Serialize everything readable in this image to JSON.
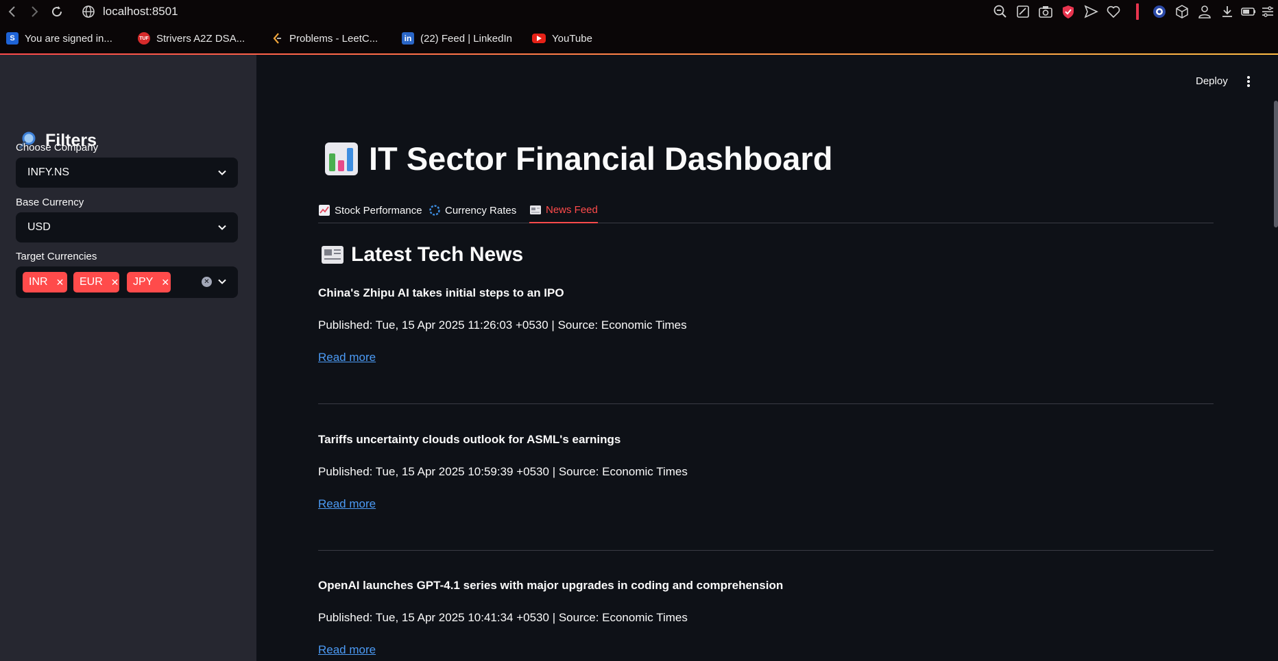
{
  "browser": {
    "url": "localhost:8501",
    "bookmarks": [
      {
        "label": "You are signed in...",
        "icon": "s-logo-icon"
      },
      {
        "label": "Strivers A2Z DSA...",
        "icon": "tuf-logo-icon"
      },
      {
        "label": "Problems - LeetC...",
        "icon": "leetcode-logo-icon"
      },
      {
        "label": "(22) Feed | LinkedIn",
        "icon": "linkedin-logo-icon"
      },
      {
        "label": "YouTube",
        "icon": "youtube-logo-icon"
      }
    ]
  },
  "sidebar": {
    "title": "Filters",
    "company": {
      "label": "Choose Company",
      "value": "INFY.NS"
    },
    "base_currency": {
      "label": "Base Currency",
      "value": "USD"
    },
    "target_currencies": {
      "label": "Target Currencies",
      "tags": [
        "INR",
        "EUR",
        "JPY"
      ]
    }
  },
  "header": {
    "deploy_label": "Deploy"
  },
  "main": {
    "title": "IT Sector Financial Dashboard",
    "tabs": [
      {
        "label": "Stock Performance",
        "icon": "chart-up-icon"
      },
      {
        "label": "Currency Rates",
        "icon": "globe-spin-icon"
      },
      {
        "label": "News Feed",
        "icon": "newspaper-icon",
        "active": true
      }
    ],
    "section_title": "Latest Tech News",
    "news": [
      {
        "title": "China's Zhipu AI takes initial steps to an IPO",
        "meta": "Published: Tue, 15 Apr 2025 11:26:03 +0530 | Source: Economic Times",
        "link": "Read more"
      },
      {
        "title": "Tariffs uncertainty clouds outlook for ASML's earnings",
        "meta": "Published: Tue, 15 Apr 2025 10:59:39 +0530 | Source: Economic Times",
        "link": "Read more"
      },
      {
        "title": "OpenAI launches GPT-4.1 series with major upgrades in coding and comprehension",
        "meta": "Published: Tue, 15 Apr 2025 10:41:34 +0530 | Source: Economic Times",
        "link": "Read more"
      }
    ]
  },
  "colors": {
    "accent": "#ff4b4b",
    "link": "#4c9bf5",
    "sidebar_bg": "#262730",
    "main_bg": "#0e1117"
  }
}
